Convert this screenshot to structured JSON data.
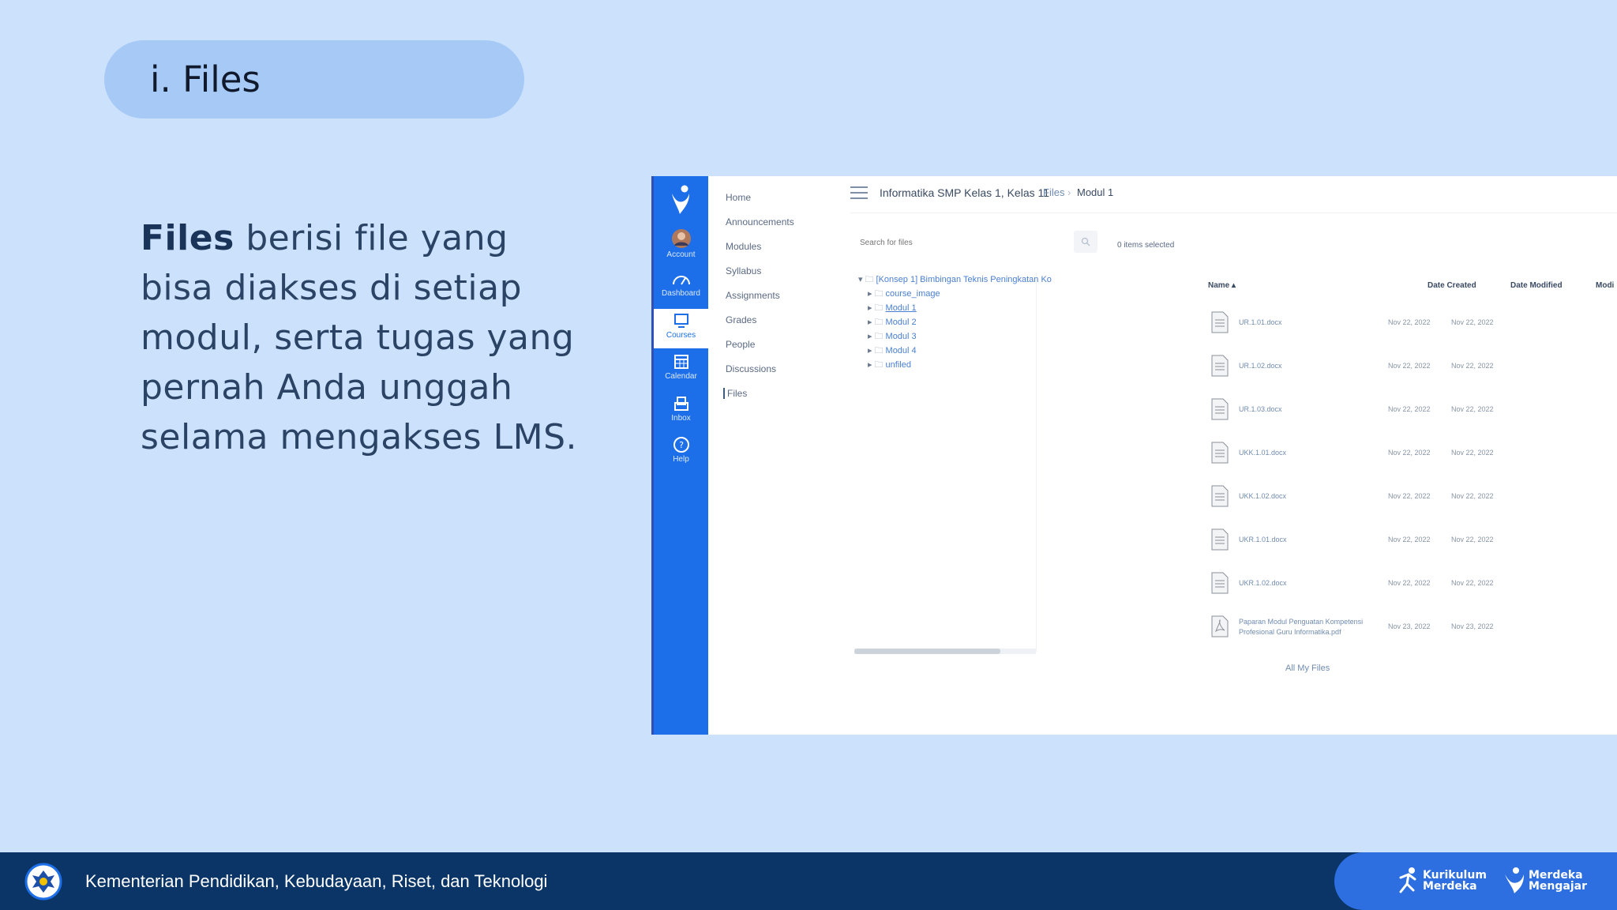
{
  "slide": {
    "title": "i. Files",
    "description_bold": "Files",
    "description_rest": " berisi file yang bisa diakses di setiap modul, serta tugas yang pernah Anda unggah selama mengakses LMS."
  },
  "lms": {
    "global_nav": [
      {
        "label": "Account",
        "icon": "account-icon"
      },
      {
        "label": "Dashboard",
        "icon": "dashboard-icon"
      },
      {
        "label": "Courses",
        "icon": "courses-icon",
        "active": true
      },
      {
        "label": "Calendar",
        "icon": "calendar-icon"
      },
      {
        "label": "Inbox",
        "icon": "inbox-icon"
      },
      {
        "label": "Help",
        "icon": "help-icon"
      }
    ],
    "course_nav": [
      "Home",
      "Announcements",
      "Modules",
      "Syllabus",
      "Assignments",
      "Grades",
      "People",
      "Discussions",
      "Files"
    ],
    "header": {
      "course_title": "Informatika SMP Kelas 1, Kelas 11",
      "breadcrumb_files": "Files",
      "breadcrumb_sep": "›",
      "breadcrumb_current": "Modul 1"
    },
    "search": {
      "placeholder": "Search for files"
    },
    "selected_count": "0 items selected",
    "tree": {
      "root": "[Konsep 1] Bimbingan Teknis Peningkatan Ko",
      "children": [
        "course_image",
        "Modul 1",
        "Modul 2",
        "Modul 3",
        "Modul 4",
        "unfiled"
      ]
    },
    "columns": {
      "name": "Name ▴",
      "created": "Date Created",
      "modified": "Date Modified",
      "extra": "Modi"
    },
    "files": [
      {
        "name": "UR.1.01.docx",
        "created": "Nov 22, 2022",
        "modified": "Nov 22, 2022"
      },
      {
        "name": "UR.1.02.docx",
        "created": "Nov 22, 2022",
        "modified": "Nov 22, 2022"
      },
      {
        "name": "UR.1.03.docx",
        "created": "Nov 22, 2022",
        "modified": "Nov 22, 2022"
      },
      {
        "name": "UKK.1.01.docx",
        "created": "Nov 22, 2022",
        "modified": "Nov 22, 2022"
      },
      {
        "name": "UKK.1.02.docx",
        "created": "Nov 22, 2022",
        "modified": "Nov 22, 2022"
      },
      {
        "name": "UKR.1.01.docx",
        "created": "Nov 22, 2022",
        "modified": "Nov 22, 2022"
      },
      {
        "name": "UKR.1.02.docx",
        "created": "Nov 22, 2022",
        "modified": "Nov 22, 2022"
      },
      {
        "name": "Paparan Modul Penguatan Kompetensi Profesional Guru Informatika.pdf",
        "created": "Nov 23, 2022",
        "modified": "Nov 23, 2022"
      }
    ],
    "all_files": "All My Files"
  },
  "footer": {
    "ministry": "Kementerian Pendidikan, Kebudayaan, Riset, dan Teknologi",
    "brand1_line1": "Kurikulum",
    "brand1_line2": "Merdeka",
    "brand2_line1": "Merdeka",
    "brand2_line2": "Mengajar"
  }
}
